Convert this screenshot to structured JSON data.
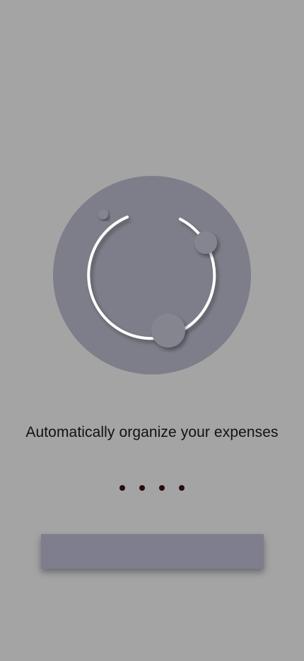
{
  "onboarding": {
    "illustration_icon": "expense-organizer-illustration",
    "tagline": "Automatically organize your expenses",
    "page_indicator": {
      "total": 4,
      "dot_color": "#2a0a0a"
    },
    "cta": {
      "label": "",
      "color": "#7e7e8e"
    }
  },
  "theme": {
    "background": "#a4a4a4",
    "accent": "#7e7e8e",
    "ring": "#ffffff",
    "text": "#141014"
  }
}
